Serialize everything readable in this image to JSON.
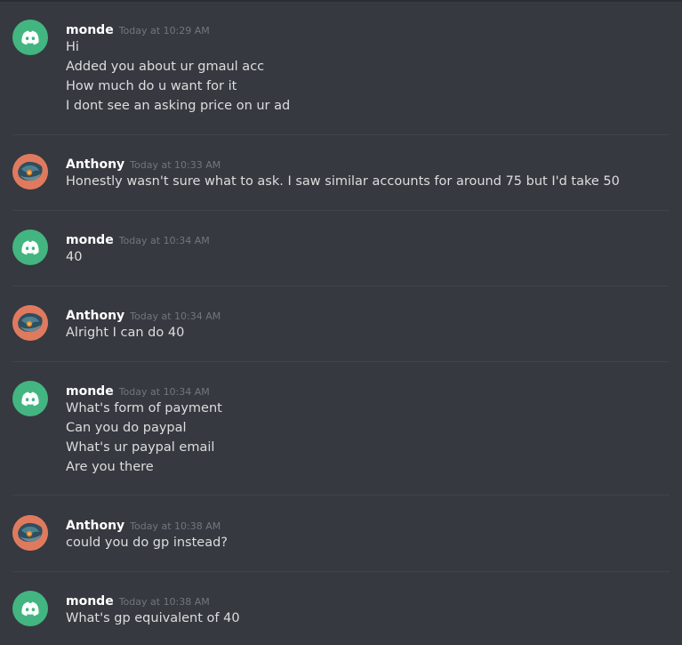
{
  "messages": [
    {
      "author": "monde",
      "timestamp": "Today at 10:29 AM",
      "avatar_icon": "discord-logo-icon",
      "lines": [
        "Hi",
        "Added you about ur gmaul acc",
        "How much do u want for it",
        "I dont see an asking price on ur ad"
      ]
    },
    {
      "author": "Anthony",
      "timestamp": "Today at 10:33 AM",
      "avatar_icon": "user-avatar-image",
      "lines": [
        "Honestly wasn't sure what to ask. I saw similar accounts for around 75 but I'd take 50"
      ]
    },
    {
      "author": "monde",
      "timestamp": "Today at 10:34 AM",
      "avatar_icon": "discord-logo-icon",
      "lines": [
        "40"
      ]
    },
    {
      "author": "Anthony",
      "timestamp": "Today at 10:34 AM",
      "avatar_icon": "user-avatar-image",
      "lines": [
        "Alright I can do 40"
      ]
    },
    {
      "author": "monde",
      "timestamp": "Today at 10:34 AM",
      "avatar_icon": "discord-logo-icon",
      "lines": [
        "What's form of payment",
        "Can you do paypal",
        "What's ur paypal email",
        "Are you there"
      ]
    },
    {
      "author": "Anthony",
      "timestamp": "Today at 10:38 AM",
      "avatar_icon": "user-avatar-image",
      "lines": [
        "could you do gp instead?"
      ]
    },
    {
      "author": "monde",
      "timestamp": "Today at 10:38 AM",
      "avatar_icon": "discord-logo-icon",
      "lines": [
        "What's gp equivalent of 40"
      ]
    }
  ],
  "colors": {
    "background": "#36393f",
    "username": "#ffffff",
    "timestamp": "#72767d",
    "message_text": "#dcddde",
    "discord_avatar": "#43b581",
    "anthony_avatar": "#e07a5f"
  }
}
